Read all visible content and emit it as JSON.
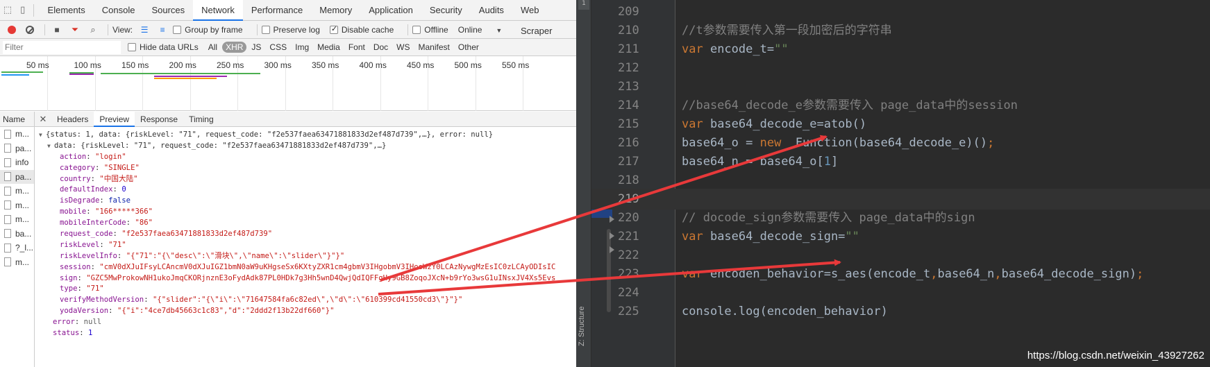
{
  "devtools": {
    "tabs": [
      "Elements",
      "Console",
      "Sources",
      "Network",
      "Performance",
      "Memory",
      "Application",
      "Security",
      "Audits",
      "Web Scraper"
    ],
    "active_tab": "Network",
    "toolbar": {
      "view_label": "View:",
      "group_by_frame": "Group by frame",
      "preserve_log": "Preserve log",
      "disable_cache": "Disable cache",
      "offline": "Offline",
      "throttle": "Online"
    },
    "filter": {
      "placeholder": "Filter",
      "hide_data_urls": "Hide data URLs",
      "types": [
        "All",
        "XHR",
        "JS",
        "CSS",
        "Img",
        "Media",
        "Font",
        "Doc",
        "WS",
        "Manifest",
        "Other"
      ],
      "active_type": "XHR"
    },
    "timeline_ticks": [
      "50 ms",
      "100 ms",
      "150 ms",
      "200 ms",
      "250 ms",
      "300 ms",
      "350 ms",
      "400 ms",
      "450 ms",
      "500 ms",
      "550 ms"
    ],
    "name_header": "Name",
    "requests": [
      "m...",
      "pa...",
      "info",
      "pa...",
      "m...",
      "m...",
      "m...",
      "ba...",
      "?_l...",
      "m..."
    ],
    "selected_request": 3,
    "detail_tabs": [
      "Headers",
      "Preview",
      "Response",
      "Timing"
    ],
    "active_detail_tab": "Preview",
    "preview": {
      "summary": "{status: 1, data: {riskLevel: \"71\", request_code: \"f2e537faea63471881833d2ef487d739\",…}, error: null}",
      "data_summary": "data: {riskLevel: \"71\", request_code: \"f2e537faea63471881833d2ef487d739\",…}",
      "fields": [
        {
          "key": "action",
          "value": "\"login\"",
          "kind": "s"
        },
        {
          "key": "category",
          "value": "\"SINGLE\"",
          "kind": "s"
        },
        {
          "key": "country",
          "value": "\"中国大陆\"",
          "kind": "s"
        },
        {
          "key": "defaultIndex",
          "value": "0",
          "kind": "n"
        },
        {
          "key": "isDegrade",
          "value": "false",
          "kind": "b"
        },
        {
          "key": "mobile",
          "value": "\"166*****366\"",
          "kind": "s"
        },
        {
          "key": "mobileInterCode",
          "value": "\"86\"",
          "kind": "s"
        },
        {
          "key": "request_code",
          "value": "\"f2e537faea63471881833d2ef487d739\"",
          "kind": "s"
        },
        {
          "key": "riskLevel",
          "value": "\"71\"",
          "kind": "s"
        },
        {
          "key": "riskLevelInfo",
          "value": "\"{\"71\":\"{\\\"desc\\\":\\\"滑块\\\",\\\"name\\\":\\\"slider\\\"}\"}\"",
          "kind": "s"
        },
        {
          "key": "session",
          "value": "\"cmV0dXJuIFsyLCAncmV0dXJuIGZ1bmN0aW9uKHgseSx6KXtyZXR1cm4gbmV3IHgobmV3IHooWzY0LCAzNywgMzEsIC0zLCAyODIsIC",
          "kind": "s"
        },
        {
          "key": "sign",
          "value": "\"GZC5MwProkowNH1ukoJmqCKORjnznE3oFydAdk87PL0HDk7g3Hh5wnD4QwjQdIQFFgHy9GB8ZoqoJXcN+b9rYo3wsG1uINsxJV4Xs5Evs",
          "kind": "s"
        },
        {
          "key": "type",
          "value": "\"71\"",
          "kind": "s"
        },
        {
          "key": "verifyMethodVersion",
          "value": "\"{\"slider\":\"{\\\"i\\\":\\\"71647584fa6c82ed\\\",\\\"d\\\":\\\"610399cd41550cd3\\\"}\"}\"",
          "kind": "s"
        },
        {
          "key": "yodaVersion",
          "value": "\"{\"i\":\"4ce7db45663c1c83\",\"d\":\"2ddd2f13b22df660\"}\"",
          "kind": "s"
        }
      ],
      "error_line": {
        "key": "error",
        "value": "null",
        "kind": "nl"
      },
      "status_line": {
        "key": "status",
        "value": "1",
        "kind": "n"
      }
    }
  },
  "ide": {
    "strip_number": "1",
    "structure_label": "Z: Structure",
    "current_line": 219,
    "lines": [
      {
        "num": "209",
        "code": ""
      },
      {
        "num": "210",
        "code": "//t参数需要传入第一段加密后的字符串"
      },
      {
        "num": "211",
        "code": "var encode_t=\"\""
      },
      {
        "num": "212",
        "code": ""
      },
      {
        "num": "213",
        "code": ""
      },
      {
        "num": "214",
        "code": "//base64_decode_e参数需要传入 page_data中的session"
      },
      {
        "num": "215",
        "code": "var base64_decode_e=atob()"
      },
      {
        "num": "216",
        "code": "base64_o = new  Function(base64_decode_e)();"
      },
      {
        "num": "217",
        "code": "base64_n = base64_o[1]"
      },
      {
        "num": "218",
        "code": ""
      },
      {
        "num": "219",
        "code": ""
      },
      {
        "num": "220",
        "code": "// docode_sign参数需要传入 page_data中的sign"
      },
      {
        "num": "221",
        "code": "var base64_decode_sign=\"\""
      },
      {
        "num": "222",
        "code": ""
      },
      {
        "num": "223",
        "code": "var encoden_behavior=s_aes(encode_t,base64_n,base64_decode_sign);"
      },
      {
        "num": "224",
        "code": ""
      },
      {
        "num": "225",
        "code": "console.log(encoden_behavior)"
      }
    ],
    "watermark": "https://blog.csdn.net/weixin_43927262"
  },
  "colors": {
    "arrow": "#e8393a",
    "ide_bg": "#2b2b2b",
    "gutter_bg": "#313335",
    "comment": "#808080",
    "keyword": "#cc7832",
    "string": "#6a8759",
    "devtools_bg": "#f3f3f3",
    "accent": "#1a73e8",
    "record": "#e53935"
  }
}
